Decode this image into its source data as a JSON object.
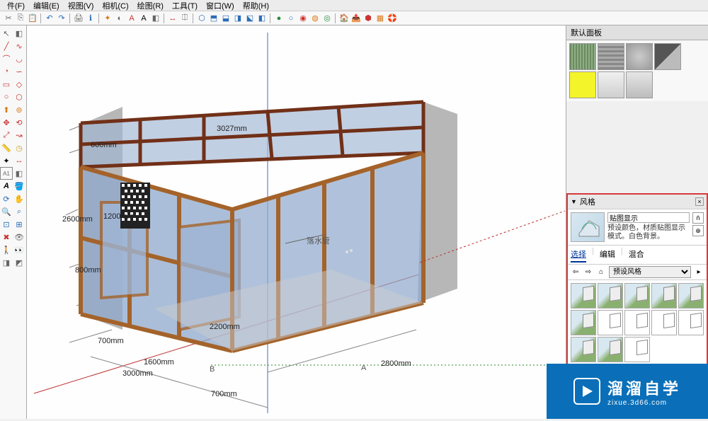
{
  "menu": {
    "items": [
      "件(F)",
      "编辑(E)",
      "视图(V)",
      "相机(C)",
      "绘图(R)",
      "工具(T)",
      "窗口(W)",
      "帮助(H)"
    ]
  },
  "panels": {
    "default_tray": "默认面板"
  },
  "style": {
    "title": "风格",
    "name_value": "贴图显示",
    "desc": "预设颜色，材质贴图显示模式。白色背景。",
    "tabs": [
      "选择",
      "编辑",
      "混合"
    ],
    "select_label": "预设风格"
  },
  "dimensions": {
    "d1": "600mm",
    "d2": "3027mm",
    "d3": "2600mm",
    "d4": "1200mm",
    "d5": "800mm",
    "d6": "700mm",
    "d7": "3000mm",
    "d8": "1600mm",
    "d9": "700mm",
    "d10": "2200mm",
    "d11": "2800mm"
  },
  "annotations": {
    "downspout": "落水管",
    "marker_a": "A",
    "marker_b": "B"
  },
  "watermark": {
    "brand": "溜溜自学",
    "sub": "zixue.3d66.com"
  }
}
